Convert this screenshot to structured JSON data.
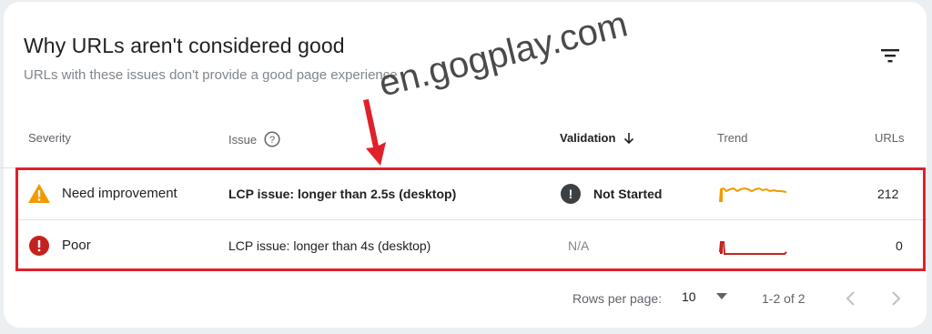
{
  "header": {
    "title": "Why URLs aren't considered good",
    "subtitle": "URLs with these issues don't provide a good page experience"
  },
  "watermark": "en.gogplay.com",
  "columns": {
    "severity": "Severity",
    "issue": "Issue",
    "validation": "Validation",
    "trend": "Trend",
    "urls": "URLs"
  },
  "rows": [
    {
      "severity": "Need improvement",
      "severity_icon": "warning-triangle-icon",
      "issue": "LCP issue: longer than 2.5s (desktop)",
      "validation": "Not Started",
      "validation_icon": "exclamation-circle-icon",
      "trend_color": "#f29900",
      "urls": "212"
    },
    {
      "severity": "Poor",
      "severity_icon": "error-circle-icon",
      "issue": "LCP issue: longer than 4s (desktop)",
      "validation": "N/A",
      "trend_color": "#c5221f",
      "urls": "0"
    }
  ],
  "pagination": {
    "rows_per_page_label": "Rows per page:",
    "rows_per_page_value": "10",
    "range": "1-2 of 2"
  },
  "colors": {
    "warning": "#f29900",
    "error": "#c5221f",
    "highlight_frame": "#e0202b",
    "annotation_arrow": "#e0202b"
  }
}
